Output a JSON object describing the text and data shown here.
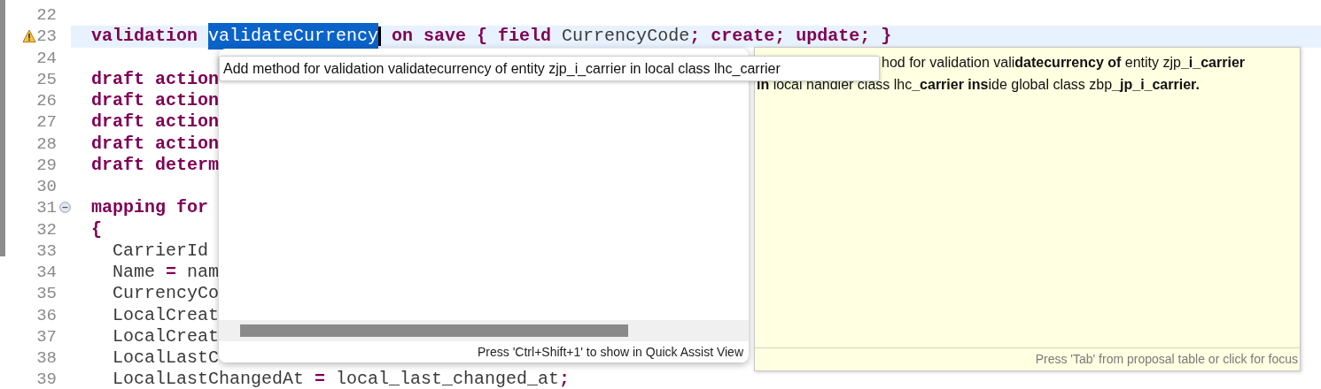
{
  "editor": {
    "lines": [
      {
        "number": "22",
        "kind": "plain",
        "highlighted": false
      },
      {
        "number": "23",
        "kind": "warning",
        "highlighted": true,
        "indented": false,
        "tokens": [
          {
            "kind": "keyword",
            "text": "validation "
          },
          {
            "kind": "selected",
            "text": "validateCurrency"
          },
          {
            "kind": "keyword",
            "text": " on save { field "
          },
          {
            "kind": "plain",
            "text": "CurrencyCode"
          },
          {
            "kind": "keyword",
            "text": "; create; update; }"
          }
        ]
      },
      {
        "number": "24",
        "kind": "plain",
        "highlighted": false
      },
      {
        "number": "25",
        "kind": "plain",
        "highlighted": false,
        "indented": false,
        "tokens": [
          {
            "kind": "keyword",
            "text": "draft action"
          }
        ]
      },
      {
        "number": "26",
        "kind": "plain",
        "highlighted": false,
        "indented": false,
        "tokens": [
          {
            "kind": "keyword",
            "text": "draft action"
          }
        ]
      },
      {
        "number": "27",
        "kind": "plain",
        "highlighted": false,
        "indented": false,
        "tokens": [
          {
            "kind": "keyword",
            "text": "draft action"
          }
        ]
      },
      {
        "number": "28",
        "kind": "plain",
        "highlighted": false,
        "indented": false,
        "tokens": [
          {
            "kind": "keyword",
            "text": "draft action"
          }
        ]
      },
      {
        "number": "29",
        "kind": "plain",
        "highlighted": false,
        "indented": false,
        "tokens": [
          {
            "kind": "keyword",
            "text": "draft determ"
          }
        ]
      },
      {
        "number": "30",
        "kind": "plain",
        "highlighted": false
      },
      {
        "number": "31",
        "kind": "fold",
        "highlighted": false,
        "indented": false,
        "tokens": [
          {
            "kind": "keyword",
            "text": "mapping for"
          }
        ]
      },
      {
        "number": "32",
        "kind": "plain",
        "highlighted": false,
        "indented": false,
        "tokens": [
          {
            "kind": "keyword",
            "text": "{"
          }
        ]
      },
      {
        "number": "33",
        "kind": "plain",
        "highlighted": false,
        "indented": true,
        "tokens": [
          {
            "kind": "plain",
            "text": "CarrierId"
          }
        ]
      },
      {
        "number": "34",
        "kind": "plain",
        "highlighted": false,
        "indented": true,
        "tokens": [
          {
            "kind": "plain",
            "text": "Name "
          },
          {
            "kind": "keyword",
            "text": "="
          },
          {
            "kind": "plain",
            "text": " nam"
          }
        ]
      },
      {
        "number": "35",
        "kind": "plain",
        "highlighted": false,
        "indented": true,
        "tokens": [
          {
            "kind": "plain",
            "text": "CurrencyCo"
          }
        ]
      },
      {
        "number": "36",
        "kind": "plain",
        "highlighted": false,
        "indented": true,
        "tokens": [
          {
            "kind": "plain",
            "text": "LocalCreat"
          }
        ]
      },
      {
        "number": "37",
        "kind": "plain",
        "highlighted": false,
        "indented": true,
        "tokens": [
          {
            "kind": "plain",
            "text": "LocalCreat"
          }
        ]
      },
      {
        "number": "38",
        "kind": "plain",
        "highlighted": false,
        "indented": true,
        "tokens": [
          {
            "kind": "plain",
            "text": "LocalLastC"
          }
        ]
      },
      {
        "number": "39",
        "kind": "plain",
        "highlighted": false,
        "indented": true,
        "tokens": [
          {
            "kind": "plain",
            "text": "LocalLastChangedAt "
          },
          {
            "kind": "keyword",
            "text": "="
          },
          {
            "kind": "plain",
            "text": " local_last_changed_at"
          },
          {
            "kind": "keyword",
            "text": ";"
          }
        ]
      }
    ]
  },
  "quick_assist": {
    "proposal_tooltip": "Add method for validation validatecurrency of entity zjp_i_carrier in local class lhc_carrier",
    "footer": "Press 'Ctrl+Shift+1' to show in Quick Assist View"
  },
  "info_panel": {
    "lines": [
      "hod for validation vali**datecurrency of** entity zjp**_i_carrier**",
      "**in** local handler class lhc**_carrier ins**ide global class zbp**_jp_i_carrier.**"
    ],
    "footer": "Press 'Tab' from proposal table or click for focus"
  }
}
